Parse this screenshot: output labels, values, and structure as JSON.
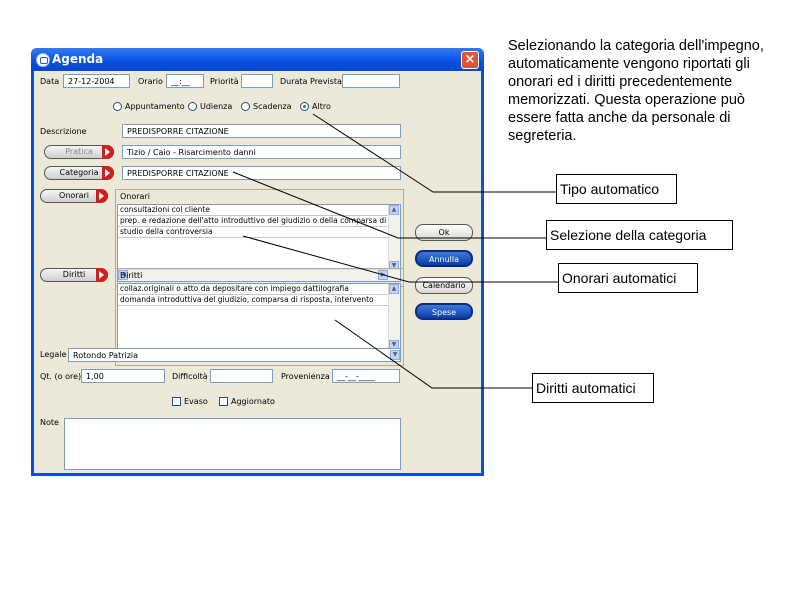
{
  "window": {
    "title": "Agenda",
    "close_glyph": "×"
  },
  "form": {
    "data_label": "Data",
    "data_value": "27-12-2004",
    "orario_label": "Orario",
    "orario_value": "__:__",
    "priorita_label": "Priorità",
    "priorita_value": "",
    "durata_label": "Durata Prevista",
    "durata_value": "",
    "radios": [
      {
        "label": "Appuntamento",
        "checked": false
      },
      {
        "label": "Udienza",
        "checked": false
      },
      {
        "label": "Scadenza",
        "checked": false
      },
      {
        "label": "Altro",
        "checked": true
      }
    ],
    "descrizione_label": "Descrizione",
    "descrizione_value": "PREDISPORRE CITAZIONE",
    "pratica_button": "Pratica",
    "pratica_value": "Tizio / Caio - Risarcimento danni",
    "categoria_button": "Categoria",
    "categoria_value": "PREDISPORRE CITAZIONE",
    "onorari_button": "Onorari",
    "onorari_group_title": "Onorari",
    "onorari_rows": [
      "consultazioni col cliente",
      "prep. e redazione dell'atto introduttivo del giudizio o della comparsa di ris",
      "studio della controversia"
    ],
    "diritti_button": "Diritti",
    "diritti_group_title": "Diritti",
    "diritti_rows": [
      "collaz.originali o atto da depositare con impiego dattilografia",
      "domanda introduttiva del giudizio, comparsa di risposta, intervento"
    ],
    "legale_label": "Legale",
    "legale_value": "Rotondo Patrizia",
    "qt_label": "Qt. (o ore)",
    "qt_value": "1,00",
    "difficolta_label": "Difficoltà",
    "difficolta_value": "",
    "provenienza_label": "Provenienza",
    "provenienza_value": "__-__-____",
    "evaso_label": "Evaso",
    "evaso_checked": false,
    "aggiornato_label": "Aggiornato",
    "aggiornato_checked": false,
    "note_label": "Note",
    "note_value": ""
  },
  "buttons": {
    "ok": "Ok",
    "annulla": "Annulla",
    "calendario": "Calendario",
    "spese": "Spese"
  },
  "annotations": {
    "description": "Selezionando la categoria dell'impegno, automaticamente vengono riportati gli onorari ed i diritti precedentemente memorizzati. Questa operazione può essere fatta anche da personale di segreteria.",
    "tipo_automatico": "Tipo automatico",
    "selezione_categoria": "Selezione della categoria",
    "onorari_automatici": "Onorari automatici",
    "diritti_automatici": "Diritti automatici"
  },
  "colors": {
    "titlebar": "#0a4fe0",
    "dialog_bg": "#ece9d8",
    "accent_red": "#cc2020"
  },
  "icons": [
    "app-icon",
    "close-icon",
    "dropdown-arrow-icon",
    "scroll-up-icon",
    "scroll-down-icon",
    "scroll-left-icon",
    "scroll-right-icon"
  ]
}
